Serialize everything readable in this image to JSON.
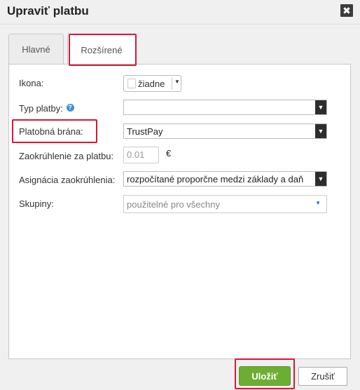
{
  "dialog": {
    "title": "Upraviť platbu",
    "close_glyph": "✖"
  },
  "tabs": [
    {
      "label": "Hlavné",
      "active": false
    },
    {
      "label": "Rozšírené",
      "active": true
    }
  ],
  "form": {
    "icon": {
      "label": "Ikona:",
      "value": "žiadne"
    },
    "payment_type": {
      "label": "Typ platby:",
      "help_glyph": "?",
      "value": ""
    },
    "payment_gateway": {
      "label": "Platobná brána:",
      "value": "TrustPay"
    },
    "rounding": {
      "label": "Zaokrúhlenie za platbu:",
      "placeholder": "0.01",
      "unit": "€"
    },
    "rounding_assignment": {
      "label": "Asignácia zaokrúhlenia:",
      "value": "rozpočítané proporčne medzi základy a daň"
    },
    "groups": {
      "label": "Skupiny:",
      "value": "použitelné pro všechny"
    }
  },
  "footer": {
    "save_label": "Uložiť",
    "cancel_label": "Zrušiť"
  },
  "colors": {
    "highlight": "#d9163b",
    "save_button": "#6cae34",
    "help_icon": "#3a8fd8"
  },
  "icons": {
    "dropdown_arrow": "▼",
    "caret": "▼"
  }
}
